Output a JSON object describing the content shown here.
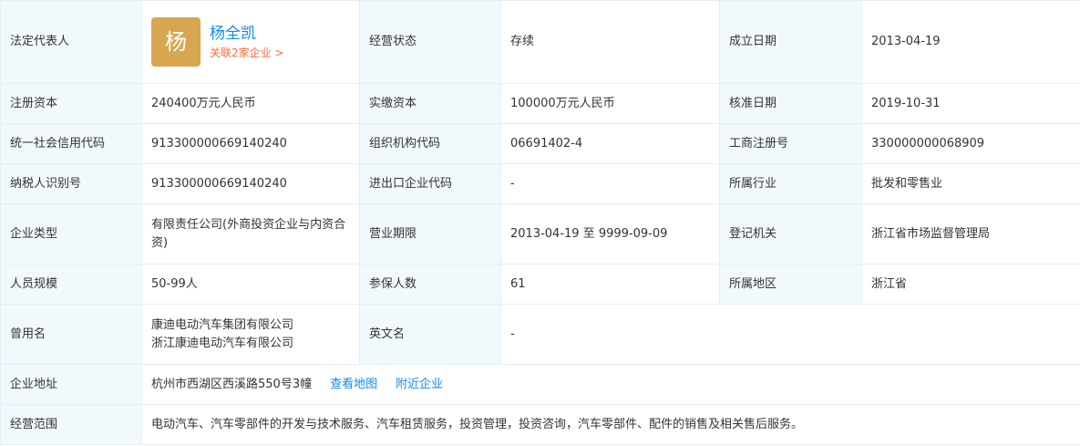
{
  "legal_rep": {
    "label": "法定代表人",
    "avatar_char": "杨",
    "name": "杨全凯",
    "related": "关联2家企业 >"
  },
  "rows": {
    "status": {
      "label": "经营状态",
      "value": "存续"
    },
    "founded": {
      "label": "成立日期",
      "value": "2013-04-19"
    },
    "reg_capital": {
      "label": "注册资本",
      "value": "240400万元人民币"
    },
    "paid_capital": {
      "label": "实缴资本",
      "value": "100000万元人民币"
    },
    "approve_date": {
      "label": "核准日期",
      "value": "2019-10-31"
    },
    "credit_code": {
      "label": "统一社会信用代码",
      "value": "913300000669140240"
    },
    "org_code": {
      "label": "组织机构代码",
      "value": "06691402-4"
    },
    "biz_reg_no": {
      "label": "工商注册号",
      "value": "330000000068909"
    },
    "taxpayer_id": {
      "label": "纳税人识别号",
      "value": "913300000669140240"
    },
    "import_export": {
      "label": "进出口企业代码",
      "value": "-"
    },
    "industry": {
      "label": "所属行业",
      "value": "批发和零售业"
    },
    "company_type": {
      "label": "企业类型",
      "value": "有限责任公司(外商投资企业与内资合资)"
    },
    "biz_term": {
      "label": "营业期限",
      "value": "2013-04-19 至 9999-09-09"
    },
    "reg_authority": {
      "label": "登记机关",
      "value": "浙江省市场监督管理局"
    },
    "staff_size": {
      "label": "人员规模",
      "value": "50-99人"
    },
    "insured": {
      "label": "参保人数",
      "value": "61"
    },
    "region": {
      "label": "所属地区",
      "value": "浙江省"
    },
    "former_names": {
      "label": "曾用名",
      "values": [
        "康迪电动汽车集团有限公司",
        "浙江康迪电动汽车有限公司"
      ]
    },
    "english_name": {
      "label": "英文名",
      "value": "-"
    },
    "address": {
      "label": "企业地址",
      "value": "杭州市西湖区西溪路550号3幢",
      "map_link": "查看地图",
      "nearby_link": "附近企业"
    },
    "scope": {
      "label": "经营范围",
      "value": "电动汽车、汽车零部件的开发与技术服务、汽车租赁服务，投资管理，投资咨询，汽车零部件、配件的销售及相关售后服务。"
    }
  },
  "colors": {
    "label_bg": "#f2f9fc",
    "border": "#e4eef6",
    "link": "#128bed",
    "related": "#fd6e3b",
    "avatar_bg": "#d6a651"
  }
}
